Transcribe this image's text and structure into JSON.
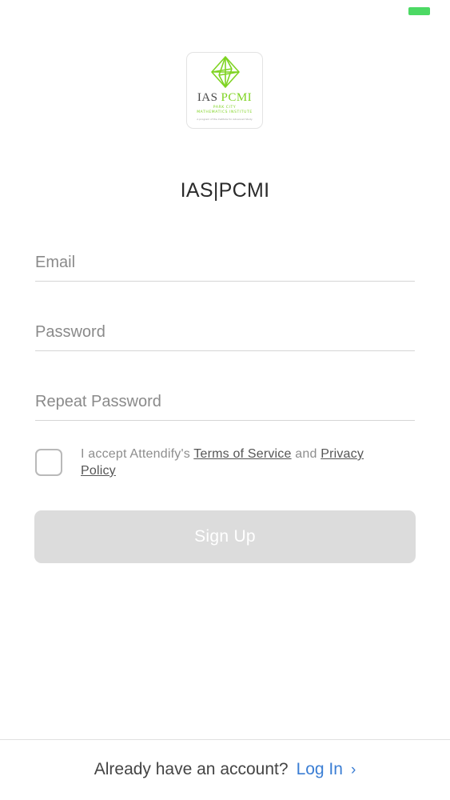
{
  "status_bar": {
    "battery_color": "#4cd964"
  },
  "logo": {
    "icon": "octahedron-logo-icon",
    "ias": "IAS",
    "pcmi": "PCMI",
    "subtitle_line1": "PARK CITY",
    "subtitle_line2": "MATHEMATICS INSTITUTE",
    "fine_print": "A program of the Institute for Advanced Study",
    "accent_color": "#7ed321"
  },
  "app_title": "IAS|PCMI",
  "form": {
    "email": {
      "placeholder": "Email",
      "value": ""
    },
    "password": {
      "placeholder": "Password",
      "value": ""
    },
    "repeat_password": {
      "placeholder": "Repeat Password",
      "value": ""
    }
  },
  "terms": {
    "prefix": "I accept Attendify's ",
    "tos_link": "Terms of Service",
    "middle": " and ",
    "privacy_link": "Privacy Policy"
  },
  "signup_button": {
    "label": "Sign Up",
    "disabled_color": "#dcdcdc"
  },
  "footer": {
    "prompt": "Already have an account?",
    "login_label": "Log In",
    "chevron": "›",
    "chevron_icon": "chevron-right-icon",
    "link_color": "#3b7ed4"
  }
}
